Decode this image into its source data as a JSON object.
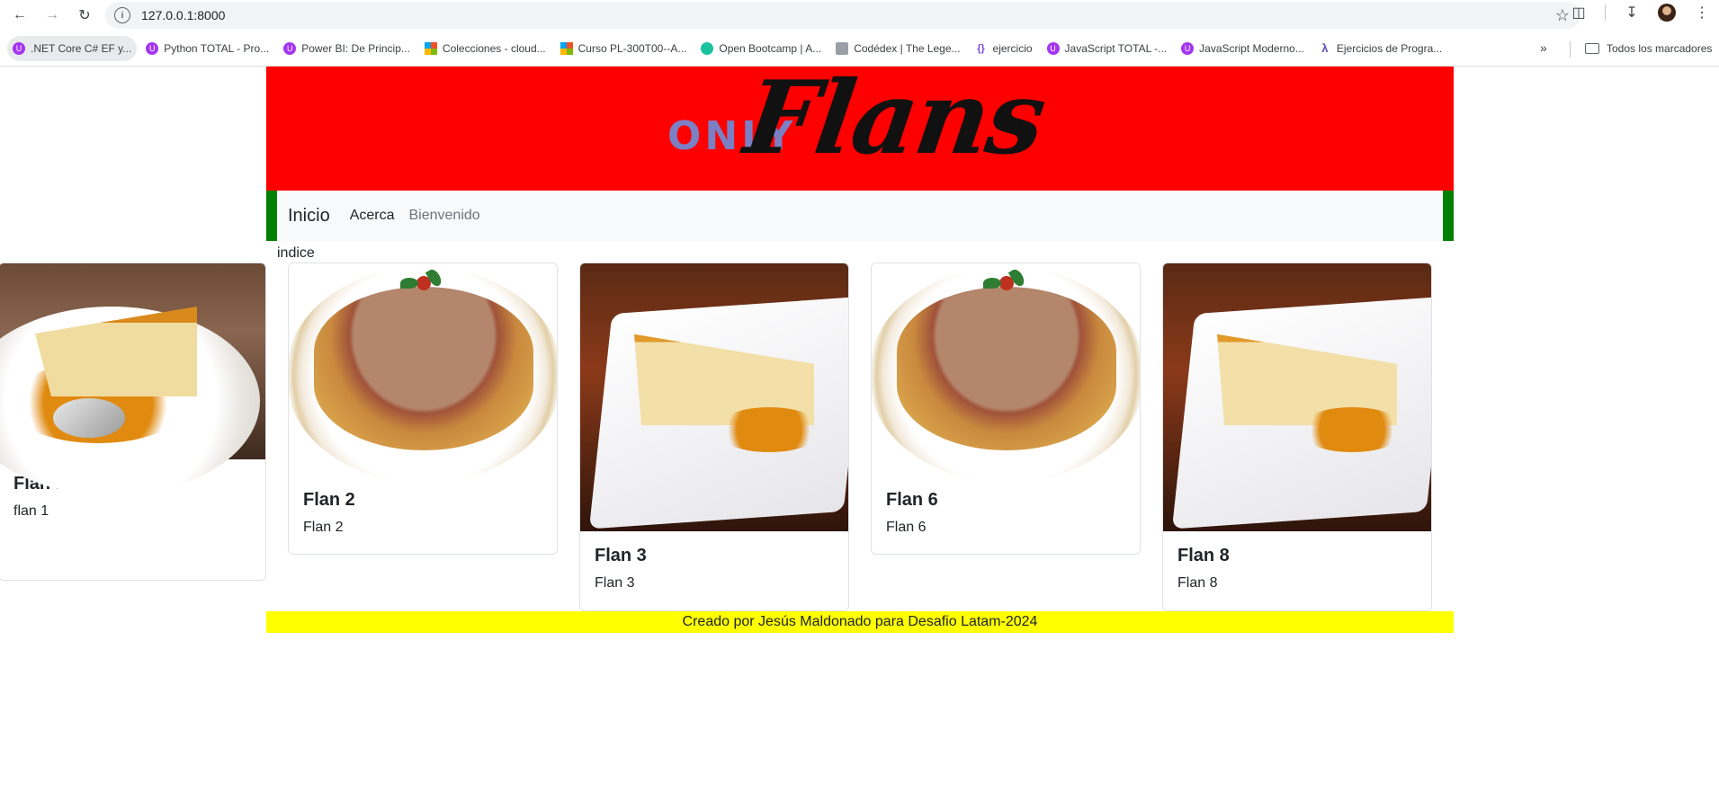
{
  "browser": {
    "url": "127.0.0.1:8000",
    "bookmarks": [
      {
        "label": ".NET Core C# EF y...",
        "icon": "udemy-icon"
      },
      {
        "label": "Python TOTAL - Pro...",
        "icon": "udemy-icon"
      },
      {
        "label": "Power BI: De Princip...",
        "icon": "udemy-icon"
      },
      {
        "label": "Colecciones - cloud...",
        "icon": "microsoft-icon"
      },
      {
        "label": "Curso PL-300T00--A...",
        "icon": "microsoft-icon"
      },
      {
        "label": "Open Bootcamp | A...",
        "icon": "openbootcamp-icon"
      },
      {
        "label": "Codédex | The Lege...",
        "icon": "codedex-icon"
      },
      {
        "label": "ejercicio",
        "icon": "braces-icon"
      },
      {
        "label": "JavaScript TOTAL -...",
        "icon": "udemy-icon"
      },
      {
        "label": "JavaScript Moderno...",
        "icon": "udemy-icon"
      },
      {
        "label": "Ejercicios de Progra...",
        "icon": "lambda-icon"
      }
    ],
    "all_bookmarks_label": "Todos los marcadores"
  },
  "header": {
    "logo_only": "ONLY",
    "logo_flans": "Flans",
    "colors": {
      "banner": "#ff0000",
      "nav_border": "#008000",
      "footer": "#ffff00"
    }
  },
  "navbar": {
    "brand": "Inicio",
    "links": [
      "Acerca",
      "Bienvenido"
    ]
  },
  "main": {
    "heading": "indice",
    "cards": [
      {
        "title": "Flan 1",
        "text": "flan 1",
        "image": "flan-slice-spoon"
      },
      {
        "title": "Flan 2",
        "text": "Flan 2",
        "image": "flan-whole"
      },
      {
        "title": "Flan 3",
        "text": "Flan 3",
        "image": "flan-square-plate"
      },
      {
        "title": "Flan 6",
        "text": "Flan 6",
        "image": "flan-whole"
      },
      {
        "title": "Flan 8",
        "text": "Flan 8",
        "image": "flan-square-plate"
      }
    ]
  },
  "footer": {
    "text": "Creado por Jesús Maldonado para Desafio Latam-2024"
  }
}
